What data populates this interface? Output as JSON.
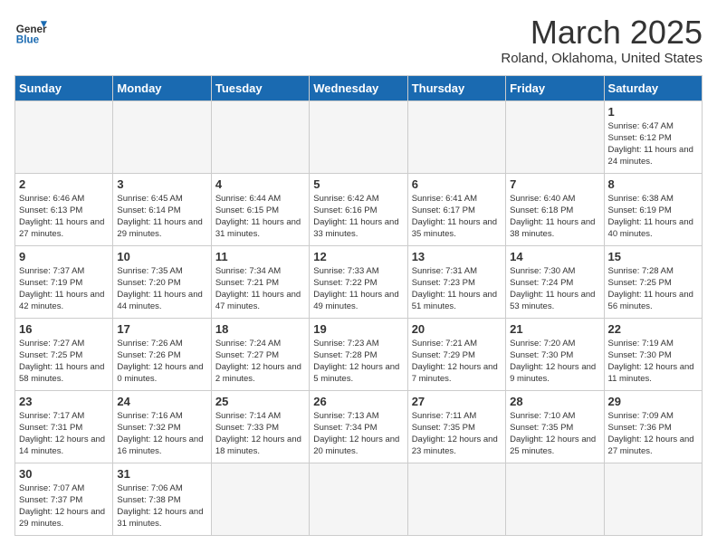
{
  "header": {
    "logo_general": "General",
    "logo_blue": "Blue",
    "title": "March 2025",
    "subtitle": "Roland, Oklahoma, United States"
  },
  "weekdays": [
    "Sunday",
    "Monday",
    "Tuesday",
    "Wednesday",
    "Thursday",
    "Friday",
    "Saturday"
  ],
  "weeks": [
    [
      {
        "day": "",
        "info": ""
      },
      {
        "day": "",
        "info": ""
      },
      {
        "day": "",
        "info": ""
      },
      {
        "day": "",
        "info": ""
      },
      {
        "day": "",
        "info": ""
      },
      {
        "day": "",
        "info": ""
      },
      {
        "day": "1",
        "info": "Sunrise: 6:47 AM\nSunset: 6:12 PM\nDaylight: 11 hours\nand 24 minutes."
      }
    ],
    [
      {
        "day": "2",
        "info": "Sunrise: 6:46 AM\nSunset: 6:13 PM\nDaylight: 11 hours\nand 27 minutes."
      },
      {
        "day": "3",
        "info": "Sunrise: 6:45 AM\nSunset: 6:14 PM\nDaylight: 11 hours\nand 29 minutes."
      },
      {
        "day": "4",
        "info": "Sunrise: 6:44 AM\nSunset: 6:15 PM\nDaylight: 11 hours\nand 31 minutes."
      },
      {
        "day": "5",
        "info": "Sunrise: 6:42 AM\nSunset: 6:16 PM\nDaylight: 11 hours\nand 33 minutes."
      },
      {
        "day": "6",
        "info": "Sunrise: 6:41 AM\nSunset: 6:17 PM\nDaylight: 11 hours\nand 35 minutes."
      },
      {
        "day": "7",
        "info": "Sunrise: 6:40 AM\nSunset: 6:18 PM\nDaylight: 11 hours\nand 38 minutes."
      },
      {
        "day": "8",
        "info": "Sunrise: 6:38 AM\nSunset: 6:19 PM\nDaylight: 11 hours\nand 40 minutes."
      }
    ],
    [
      {
        "day": "9",
        "info": "Sunrise: 7:37 AM\nSunset: 7:19 PM\nDaylight: 11 hours\nand 42 minutes."
      },
      {
        "day": "10",
        "info": "Sunrise: 7:35 AM\nSunset: 7:20 PM\nDaylight: 11 hours\nand 44 minutes."
      },
      {
        "day": "11",
        "info": "Sunrise: 7:34 AM\nSunset: 7:21 PM\nDaylight: 11 hours\nand 47 minutes."
      },
      {
        "day": "12",
        "info": "Sunrise: 7:33 AM\nSunset: 7:22 PM\nDaylight: 11 hours\nand 49 minutes."
      },
      {
        "day": "13",
        "info": "Sunrise: 7:31 AM\nSunset: 7:23 PM\nDaylight: 11 hours\nand 51 minutes."
      },
      {
        "day": "14",
        "info": "Sunrise: 7:30 AM\nSunset: 7:24 PM\nDaylight: 11 hours\nand 53 minutes."
      },
      {
        "day": "15",
        "info": "Sunrise: 7:28 AM\nSunset: 7:25 PM\nDaylight: 11 hours\nand 56 minutes."
      }
    ],
    [
      {
        "day": "16",
        "info": "Sunrise: 7:27 AM\nSunset: 7:25 PM\nDaylight: 11 hours\nand 58 minutes."
      },
      {
        "day": "17",
        "info": "Sunrise: 7:26 AM\nSunset: 7:26 PM\nDaylight: 12 hours\nand 0 minutes."
      },
      {
        "day": "18",
        "info": "Sunrise: 7:24 AM\nSunset: 7:27 PM\nDaylight: 12 hours\nand 2 minutes."
      },
      {
        "day": "19",
        "info": "Sunrise: 7:23 AM\nSunset: 7:28 PM\nDaylight: 12 hours\nand 5 minutes."
      },
      {
        "day": "20",
        "info": "Sunrise: 7:21 AM\nSunset: 7:29 PM\nDaylight: 12 hours\nand 7 minutes."
      },
      {
        "day": "21",
        "info": "Sunrise: 7:20 AM\nSunset: 7:30 PM\nDaylight: 12 hours\nand 9 minutes."
      },
      {
        "day": "22",
        "info": "Sunrise: 7:19 AM\nSunset: 7:30 PM\nDaylight: 12 hours\nand 11 minutes."
      }
    ],
    [
      {
        "day": "23",
        "info": "Sunrise: 7:17 AM\nSunset: 7:31 PM\nDaylight: 12 hours\nand 14 minutes."
      },
      {
        "day": "24",
        "info": "Sunrise: 7:16 AM\nSunset: 7:32 PM\nDaylight: 12 hours\nand 16 minutes."
      },
      {
        "day": "25",
        "info": "Sunrise: 7:14 AM\nSunset: 7:33 PM\nDaylight: 12 hours\nand 18 minutes."
      },
      {
        "day": "26",
        "info": "Sunrise: 7:13 AM\nSunset: 7:34 PM\nDaylight: 12 hours\nand 20 minutes."
      },
      {
        "day": "27",
        "info": "Sunrise: 7:11 AM\nSunset: 7:35 PM\nDaylight: 12 hours\nand 23 minutes."
      },
      {
        "day": "28",
        "info": "Sunrise: 7:10 AM\nSunset: 7:35 PM\nDaylight: 12 hours\nand 25 minutes."
      },
      {
        "day": "29",
        "info": "Sunrise: 7:09 AM\nSunset: 7:36 PM\nDaylight: 12 hours\nand 27 minutes."
      }
    ],
    [
      {
        "day": "30",
        "info": "Sunrise: 7:07 AM\nSunset: 7:37 PM\nDaylight: 12 hours\nand 29 minutes."
      },
      {
        "day": "31",
        "info": "Sunrise: 7:06 AM\nSunset: 7:38 PM\nDaylight: 12 hours\nand 31 minutes."
      },
      {
        "day": "",
        "info": ""
      },
      {
        "day": "",
        "info": ""
      },
      {
        "day": "",
        "info": ""
      },
      {
        "day": "",
        "info": ""
      },
      {
        "day": "",
        "info": ""
      }
    ]
  ]
}
